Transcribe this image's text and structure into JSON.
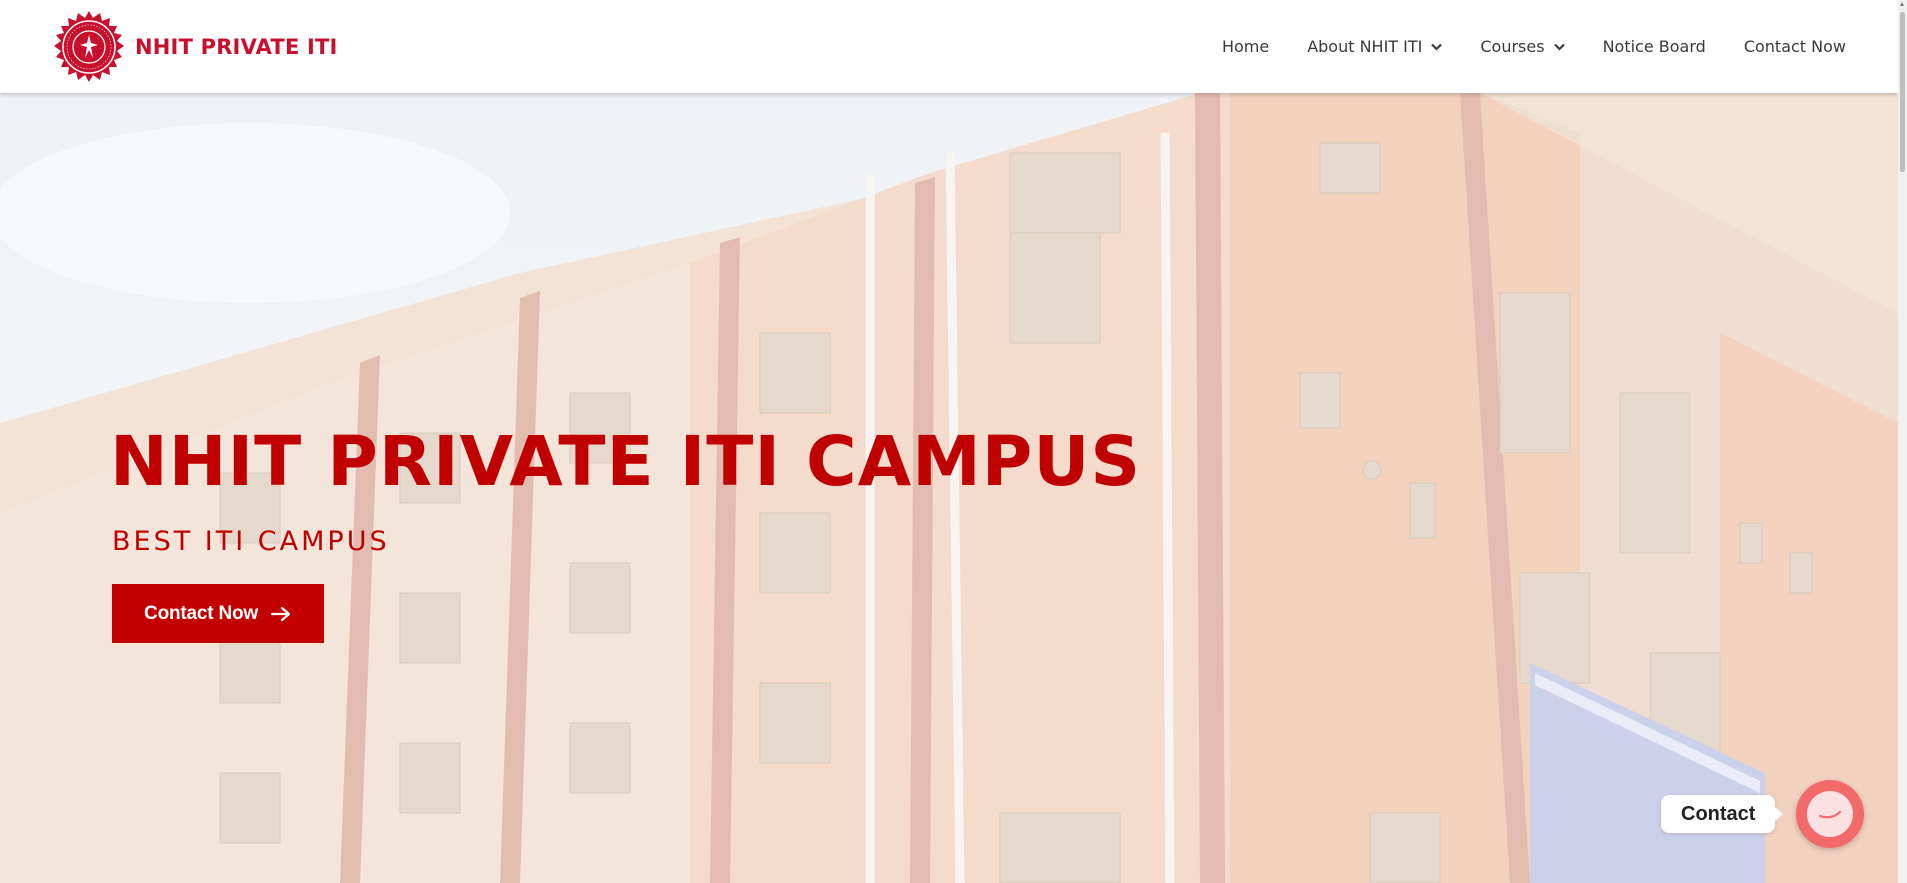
{
  "brand": {
    "name": "NHIT PRIVATE ITI",
    "logo_icon": "college-seal-icon",
    "brand_color": "#c8102e"
  },
  "nav": {
    "items": [
      {
        "label": "Home",
        "dropdown": false
      },
      {
        "label": "About NHIT ITI",
        "dropdown": true
      },
      {
        "label": "Courses",
        "dropdown": true
      },
      {
        "label": "Notice Board",
        "dropdown": false
      },
      {
        "label": "Contact Now",
        "dropdown": false
      }
    ]
  },
  "hero": {
    "title": "NHIT PRIVATE ITI CAMPUS",
    "subtitle": "BEST ITI CAMPUS",
    "cta_label": "Contact Now",
    "cta_icon": "arrow-right-icon",
    "accent_color": "#c30000",
    "background_icon": "campus-building-photo"
  },
  "floating_contact": {
    "label": "Contact",
    "icon": "chat-bubble-icon",
    "bubble_color": "#f26a6a"
  }
}
